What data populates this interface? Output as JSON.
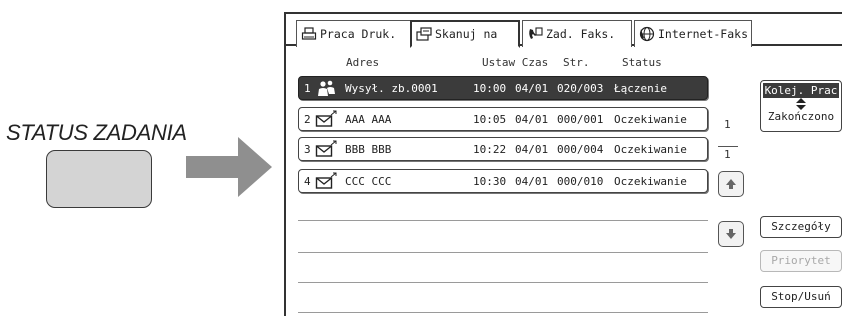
{
  "hardware": {
    "status_key_label": "STATUS ZADANIA"
  },
  "tabs": [
    {
      "label": "Praca Druk.",
      "icon": "printer-icon"
    },
    {
      "label": "Skanuj na",
      "icon": "scanner-icon"
    },
    {
      "label": "Zad. Faks.",
      "icon": "fax-icon"
    },
    {
      "label": "Internet-Faks",
      "icon": "internet-fax-icon"
    }
  ],
  "columns": {
    "address": "Adres",
    "setup_time": "Ustaw Czas",
    "pages": "Str.",
    "status": "Status"
  },
  "jobs": [
    {
      "num": "1",
      "address": "Wysył. zb.0001",
      "time": "10:00",
      "date": "04/01",
      "pages": "020/003",
      "status": "Łączenie",
      "icon": "group-send-icon"
    },
    {
      "num": "2",
      "address": "AAA AAA",
      "time": "10:05",
      "date": "04/01",
      "pages": "000/001",
      "status": "Oczekiwanie",
      "icon": "email-icon"
    },
    {
      "num": "3",
      "address": "BBB BBB",
      "time": "10:22",
      "date": "04/01",
      "pages": "000/004",
      "status": "Oczekiwanie",
      "icon": "email-icon"
    },
    {
      "num": "4",
      "address": "CCC CCC",
      "time": "10:30",
      "date": "04/01",
      "pages": "000/010",
      "status": "Oczekiwanie",
      "icon": "email-icon"
    }
  ],
  "pagination": {
    "current": "1",
    "total": "1"
  },
  "side_buttons": {
    "queue": "Kolej. Prac",
    "completed": "Zakończono",
    "details": "Szczegóły",
    "priority": "Priorytet",
    "stop_delete": "Stop/Usuń"
  }
}
